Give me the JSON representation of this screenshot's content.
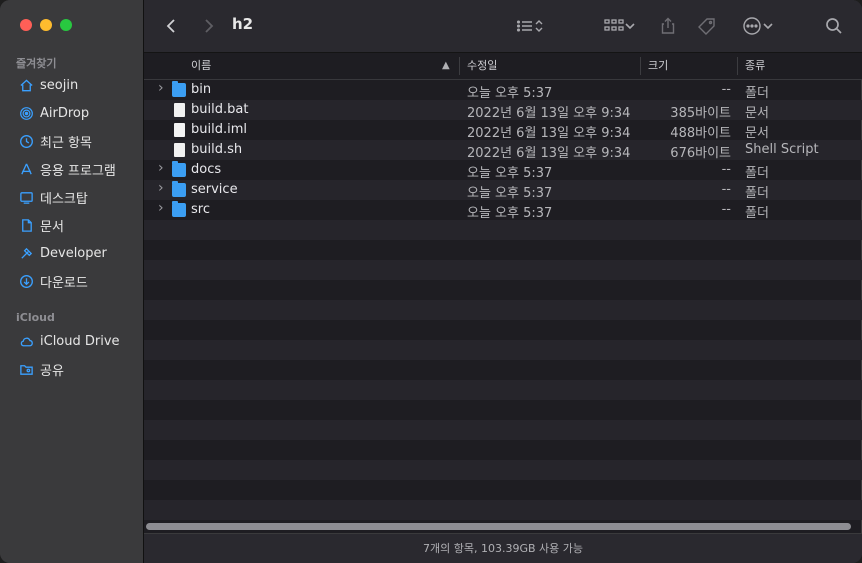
{
  "window": {
    "title": "h2"
  },
  "sidebar": {
    "favorites_label": "즐겨찾기",
    "favorites": [
      {
        "label": "seojin",
        "icon": "home-icon"
      },
      {
        "label": "AirDrop",
        "icon": "airdrop-icon"
      },
      {
        "label": "최근 항목",
        "icon": "clock-icon"
      },
      {
        "label": "응용 프로그램",
        "icon": "applications-icon"
      },
      {
        "label": "데스크탑",
        "icon": "desktop-icon"
      },
      {
        "label": "문서",
        "icon": "document-icon"
      },
      {
        "label": "Developer",
        "icon": "hammer-icon"
      },
      {
        "label": "다운로드",
        "icon": "download-icon"
      }
    ],
    "icloud_label": "iCloud",
    "icloud": [
      {
        "label": "iCloud Drive",
        "icon": "cloud-icon"
      },
      {
        "label": "공유",
        "icon": "shared-folder-icon"
      }
    ]
  },
  "columns": {
    "name": "이름",
    "date": "수정일",
    "size": "크기",
    "kind": "종류"
  },
  "files": [
    {
      "name": "bin",
      "date": "오늘 오후 5:37",
      "size": "--",
      "kind": "폴더",
      "type": "folder"
    },
    {
      "name": "build.bat",
      "date": "2022년 6월 13일 오후 9:34",
      "size": "385바이트",
      "kind": "문서",
      "type": "doc"
    },
    {
      "name": "build.iml",
      "date": "2022년 6월 13일 오후 9:34",
      "size": "488바이트",
      "kind": "문서",
      "type": "doc"
    },
    {
      "name": "build.sh",
      "date": "2022년 6월 13일 오후 9:34",
      "size": "676바이트",
      "kind": "Shell Script",
      "type": "doc"
    },
    {
      "name": "docs",
      "date": "오늘 오후 5:37",
      "size": "--",
      "kind": "폴더",
      "type": "folder"
    },
    {
      "name": "service",
      "date": "오늘 오후 5:37",
      "size": "--",
      "kind": "폴더",
      "type": "folder"
    },
    {
      "name": "src",
      "date": "오늘 오후 5:37",
      "size": "--",
      "kind": "폴더",
      "type": "folder"
    }
  ],
  "status": {
    "text": "7개의 항목, 103.39GB 사용 가능"
  },
  "colors": {
    "folder": "#3b9ef3",
    "accent": "#3aa0ff"
  }
}
